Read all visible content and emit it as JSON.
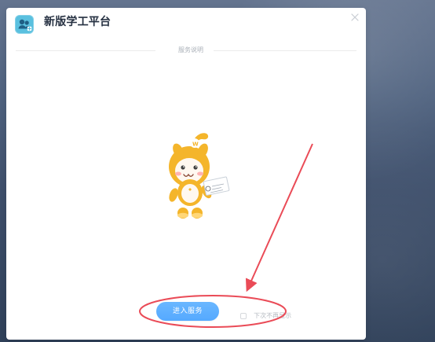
{
  "window": {
    "title": "新版学工平台",
    "close_icon": "close-icon",
    "app_icon": "user-group-icon"
  },
  "content": {
    "section_title": "服务说明",
    "mascot_icon": "mascot-icon"
  },
  "footer": {
    "enter_button_label": "进入服务",
    "checkbox_label": "下次不再显示",
    "checkbox_checked": false
  },
  "annotation": {
    "arrow_color": "#ea4b57",
    "ellipse_color": "#ea4b57"
  },
  "colors": {
    "button_accent": "#58aaff",
    "mascot_primary": "#f4b52b",
    "mascot_secondary": "#fff8f0"
  }
}
